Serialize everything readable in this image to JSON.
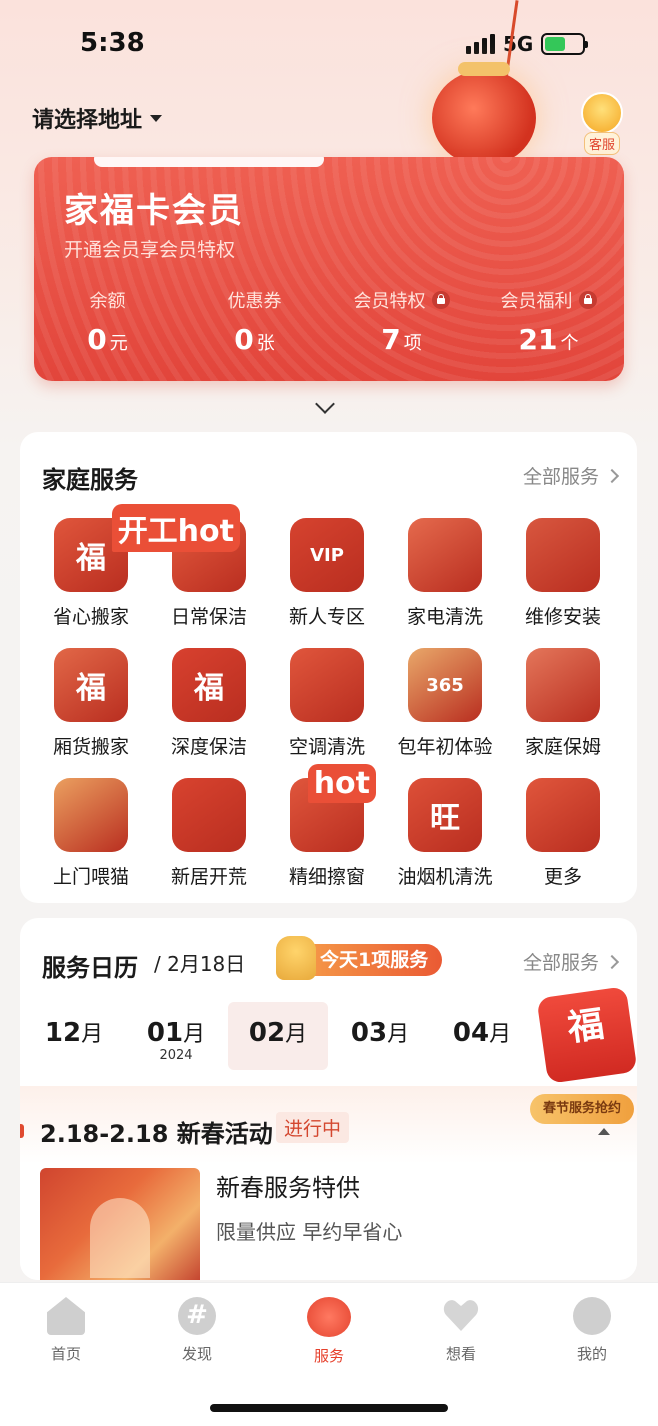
{
  "status": {
    "time": "5:38",
    "network": "5G"
  },
  "header": {
    "address_label": "请选择地址",
    "kefu_label": "客服"
  },
  "member_card": {
    "title": "家福卡会员",
    "subtitle": "开通会员享会员特权",
    "stats": [
      {
        "label": "余额",
        "value": "0",
        "unit": "元",
        "locked": false
      },
      {
        "label": "优惠券",
        "value": "0",
        "unit": "张",
        "locked": false
      },
      {
        "label": "会员特权",
        "value": "7",
        "unit": "项",
        "locked": true
      },
      {
        "label": "会员福利",
        "value": "21",
        "unit": "个",
        "locked": true
      }
    ]
  },
  "family_services": {
    "title": "家庭服务",
    "more_label": "全部服务",
    "items": [
      {
        "label": "省心搬家",
        "icon": "moving-cart-icon",
        "glyph": "福",
        "color": "#e0563c"
      },
      {
        "label": "日常保洁",
        "icon": "cleaning-bottle-icon",
        "glyph": "",
        "color": "#e45a3e",
        "tag": "开工hot"
      },
      {
        "label": "新人专区",
        "icon": "vip-bell-icon",
        "glyph": "VIP",
        "color": "#d6432f"
      },
      {
        "label": "家电清洗",
        "icon": "washing-machine-icon",
        "glyph": "",
        "color": "#e56a4d"
      },
      {
        "label": "维修安装",
        "icon": "toolbag-icon",
        "glyph": "",
        "color": "#d8573f"
      },
      {
        "label": "厢货搬家",
        "icon": "truck-icon",
        "glyph": "福",
        "color": "#e26848"
      },
      {
        "label": "深度保洁",
        "icon": "chinese-knot-icon",
        "glyph": "福",
        "color": "#d8412f"
      },
      {
        "label": "空调清洗",
        "icon": "air-conditioner-icon",
        "glyph": "",
        "color": "#e0563c"
      },
      {
        "label": "包年初体验",
        "icon": "calendar-365-icon",
        "glyph": "365",
        "color": "#e9a86a"
      },
      {
        "label": "家庭保姆",
        "icon": "fish-dish-icon",
        "glyph": "",
        "color": "#e4765a"
      },
      {
        "label": "上门喂猫",
        "icon": "tiger-cat-icon",
        "glyph": "",
        "color": "#eba060"
      },
      {
        "label": "新居开荒",
        "icon": "drum-icon",
        "glyph": "",
        "color": "#d8432f"
      },
      {
        "label": "精细擦窗",
        "icon": "window-icon",
        "glyph": "",
        "color": "#e0563c",
        "tag": "hot"
      },
      {
        "label": "油烟机清洗",
        "icon": "range-hood-icon",
        "glyph": "旺",
        "color": "#dd5038"
      },
      {
        "label": "更多",
        "icon": "lantern-icon",
        "glyph": "",
        "color": "#e0563c"
      }
    ]
  },
  "calendar": {
    "title": "服务日历",
    "date": "2月18日",
    "today_badge": "今天1项服务",
    "more_label": "全部服务",
    "months": [
      {
        "num": "12",
        "unit": "月",
        "year": ""
      },
      {
        "num": "01",
        "unit": "月",
        "year": "2024"
      },
      {
        "num": "02",
        "unit": "月",
        "year": "",
        "selected": true
      },
      {
        "num": "03",
        "unit": "月",
        "year": ""
      },
      {
        "num": "04",
        "unit": "月",
        "year": ""
      }
    ],
    "fu_glyph": "福",
    "promo_pill": "春节服务抢约",
    "event": {
      "range": "2.18-2.18 新春活动",
      "status": "进行中",
      "name": "新春服务特供",
      "desc": "限量供应 早约早省心"
    }
  },
  "tabs": [
    {
      "label": "首页",
      "icon": "home-icon",
      "active": false
    },
    {
      "label": "发现",
      "icon": "discover-icon",
      "active": false
    },
    {
      "label": "服务",
      "icon": "service-heart-icon",
      "active": true
    },
    {
      "label": "想看",
      "icon": "wishlist-heart-icon",
      "active": false
    },
    {
      "label": "我的",
      "icon": "profile-icon",
      "active": false
    }
  ],
  "colors": {
    "brand_red": "#e2453b",
    "accent_orange": "#f0a03e"
  }
}
